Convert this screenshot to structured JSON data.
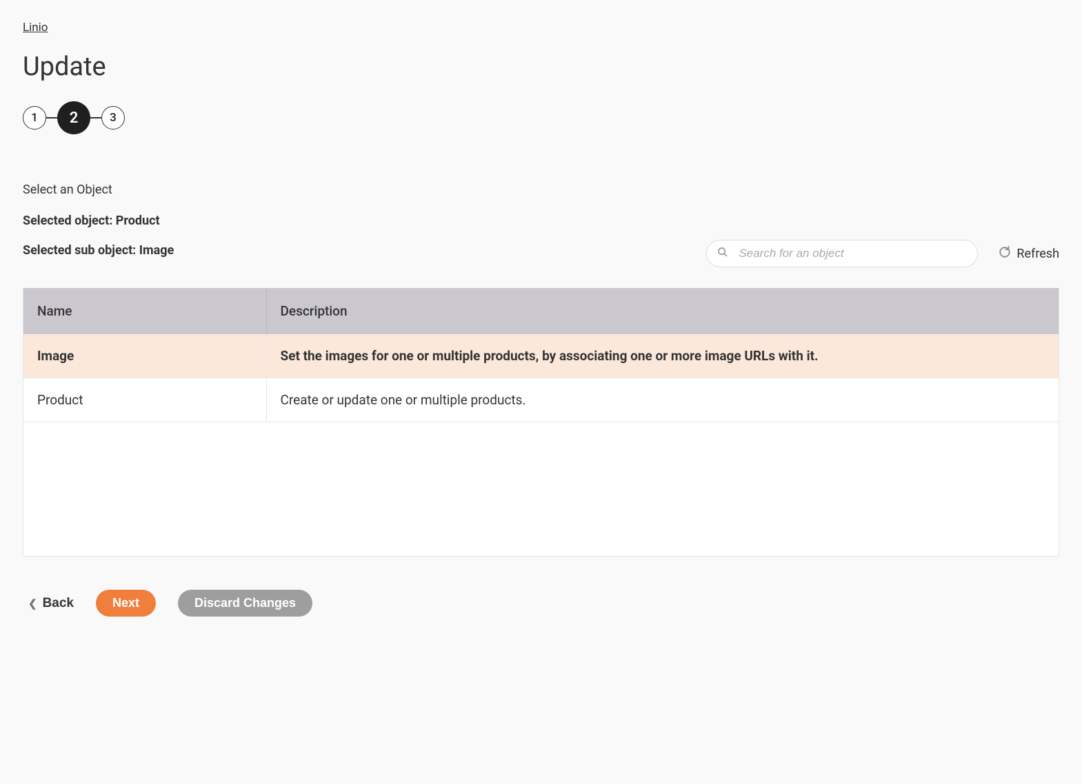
{
  "breadcrumb": {
    "label": "Linio"
  },
  "page": {
    "title": "Update"
  },
  "stepper": {
    "steps": [
      "1",
      "2",
      "3"
    ],
    "active_index": 1
  },
  "section": {
    "select_label": "Select an Object",
    "selected_object_label": "Selected object: Product",
    "selected_sub_object_label": "Selected sub object: Image"
  },
  "search": {
    "placeholder": "Search for an object",
    "value": ""
  },
  "refresh": {
    "label": "Refresh"
  },
  "table": {
    "columns": [
      "Name",
      "Description"
    ],
    "rows": [
      {
        "name": "Image",
        "description": "Set the images for one or multiple products, by associating one or more image URLs with it.",
        "selected": true
      },
      {
        "name": "Product",
        "description": "Create or update one or multiple products.",
        "selected": false
      }
    ]
  },
  "footer": {
    "back_label": "Back",
    "next_label": "Next",
    "discard_label": "Discard Changes"
  }
}
